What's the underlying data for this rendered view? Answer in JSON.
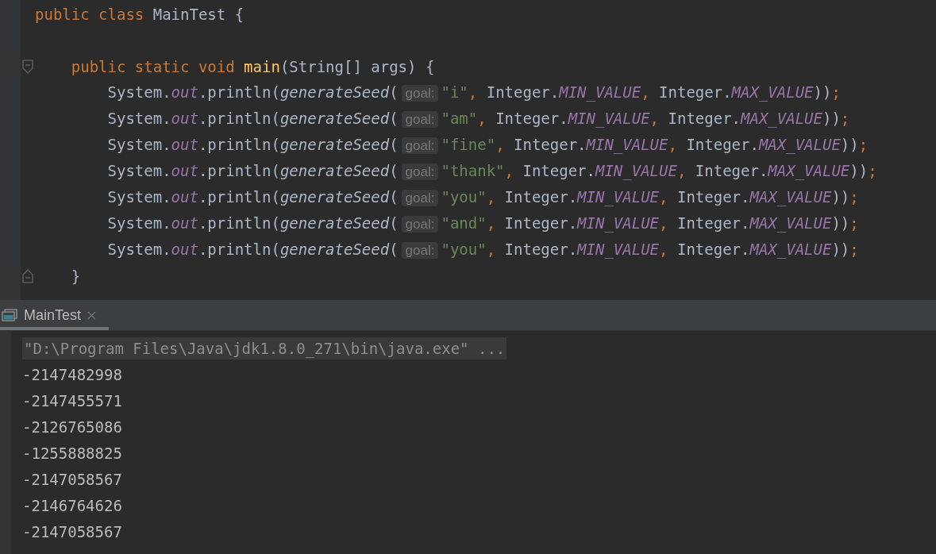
{
  "editor": {
    "lines": [
      {
        "kind": "code",
        "tokens": [
          {
            "kind": "keyword",
            "text": "public class "
          },
          {
            "kind": "plain",
            "text": "MainTest {"
          }
        ]
      },
      {
        "kind": "blank"
      },
      {
        "kind": "fold-start",
        "tokens": [
          {
            "kind": "keyword",
            "text": "    public static void "
          },
          {
            "kind": "decl",
            "text": "main"
          },
          {
            "kind": "plain",
            "text": "(String[] args) {"
          }
        ]
      },
      {
        "kind": "code",
        "tokens": [
          {
            "kind": "plain",
            "text": "        System."
          },
          {
            "kind": "field",
            "text": "out"
          },
          {
            "kind": "plain",
            "text": ".println("
          },
          {
            "kind": "static-call",
            "text": "generateSeed"
          },
          {
            "kind": "plain",
            "text": "("
          },
          {
            "kind": "hint",
            "text": "goal:"
          },
          {
            "kind": "string",
            "text": "\"i\""
          },
          {
            "kind": "punct",
            "text": ", "
          },
          {
            "kind": "plain",
            "text": "Integer."
          },
          {
            "kind": "field",
            "text": "MIN_VALUE"
          },
          {
            "kind": "punct",
            "text": ", "
          },
          {
            "kind": "plain",
            "text": "Integer."
          },
          {
            "kind": "field",
            "text": "MAX_VALUE"
          },
          {
            "kind": "plain",
            "text": "))"
          },
          {
            "kind": "punct",
            "text": ";"
          }
        ]
      },
      {
        "kind": "code",
        "tokens": [
          {
            "kind": "plain",
            "text": "        System."
          },
          {
            "kind": "field",
            "text": "out"
          },
          {
            "kind": "plain",
            "text": ".println("
          },
          {
            "kind": "static-call",
            "text": "generateSeed"
          },
          {
            "kind": "plain",
            "text": "("
          },
          {
            "kind": "hint",
            "text": "goal:"
          },
          {
            "kind": "string",
            "text": "\"am\""
          },
          {
            "kind": "punct",
            "text": ", "
          },
          {
            "kind": "plain",
            "text": "Integer."
          },
          {
            "kind": "field",
            "text": "MIN_VALUE"
          },
          {
            "kind": "punct",
            "text": ", "
          },
          {
            "kind": "plain",
            "text": "Integer."
          },
          {
            "kind": "field",
            "text": "MAX_VALUE"
          },
          {
            "kind": "plain",
            "text": "))"
          },
          {
            "kind": "punct",
            "text": ";"
          }
        ]
      },
      {
        "kind": "code",
        "tokens": [
          {
            "kind": "plain",
            "text": "        System."
          },
          {
            "kind": "field",
            "text": "out"
          },
          {
            "kind": "plain",
            "text": ".println("
          },
          {
            "kind": "static-call",
            "text": "generateSeed"
          },
          {
            "kind": "plain",
            "text": "("
          },
          {
            "kind": "hint",
            "text": "goal:"
          },
          {
            "kind": "string",
            "text": "\"fine\""
          },
          {
            "kind": "punct",
            "text": ", "
          },
          {
            "kind": "plain",
            "text": "Integer."
          },
          {
            "kind": "field",
            "text": "MIN_VALUE"
          },
          {
            "kind": "punct",
            "text": ", "
          },
          {
            "kind": "plain",
            "text": "Integer."
          },
          {
            "kind": "field",
            "text": "MAX_VALUE"
          },
          {
            "kind": "plain",
            "text": "))"
          },
          {
            "kind": "punct",
            "text": ";"
          }
        ]
      },
      {
        "kind": "code",
        "tokens": [
          {
            "kind": "plain",
            "text": "        System."
          },
          {
            "kind": "field",
            "text": "out"
          },
          {
            "kind": "plain",
            "text": ".println("
          },
          {
            "kind": "static-call",
            "text": "generateSeed"
          },
          {
            "kind": "plain",
            "text": "("
          },
          {
            "kind": "hint",
            "text": "goal:"
          },
          {
            "kind": "string",
            "text": "\"thank\""
          },
          {
            "kind": "punct",
            "text": ", "
          },
          {
            "kind": "plain",
            "text": "Integer."
          },
          {
            "kind": "field",
            "text": "MIN_VALUE"
          },
          {
            "kind": "punct",
            "text": ", "
          },
          {
            "kind": "plain",
            "text": "Integer."
          },
          {
            "kind": "field",
            "text": "MAX_VALUE"
          },
          {
            "kind": "plain",
            "text": "))"
          },
          {
            "kind": "punct",
            "text": ";"
          }
        ]
      },
      {
        "kind": "code",
        "tokens": [
          {
            "kind": "plain",
            "text": "        System."
          },
          {
            "kind": "field",
            "text": "out"
          },
          {
            "kind": "plain",
            "text": ".println("
          },
          {
            "kind": "static-call",
            "text": "generateSeed"
          },
          {
            "kind": "plain",
            "text": "("
          },
          {
            "kind": "hint",
            "text": "goal:"
          },
          {
            "kind": "string",
            "text": "\"you\""
          },
          {
            "kind": "punct",
            "text": ", "
          },
          {
            "kind": "plain",
            "text": "Integer."
          },
          {
            "kind": "field",
            "text": "MIN_VALUE"
          },
          {
            "kind": "punct",
            "text": ", "
          },
          {
            "kind": "plain",
            "text": "Integer."
          },
          {
            "kind": "field",
            "text": "MAX_VALUE"
          },
          {
            "kind": "plain",
            "text": "))"
          },
          {
            "kind": "punct",
            "text": ";"
          }
        ]
      },
      {
        "kind": "code",
        "tokens": [
          {
            "kind": "plain",
            "text": "        System."
          },
          {
            "kind": "field",
            "text": "out"
          },
          {
            "kind": "plain",
            "text": ".println("
          },
          {
            "kind": "static-call",
            "text": "generateSeed"
          },
          {
            "kind": "plain",
            "text": "("
          },
          {
            "kind": "hint",
            "text": "goal:"
          },
          {
            "kind": "string",
            "text": "\"and\""
          },
          {
            "kind": "punct",
            "text": ", "
          },
          {
            "kind": "plain",
            "text": "Integer."
          },
          {
            "kind": "field",
            "text": "MIN_VALUE"
          },
          {
            "kind": "punct",
            "text": ", "
          },
          {
            "kind": "plain",
            "text": "Integer."
          },
          {
            "kind": "field",
            "text": "MAX_VALUE"
          },
          {
            "kind": "plain",
            "text": "))"
          },
          {
            "kind": "punct",
            "text": ";"
          }
        ]
      },
      {
        "kind": "code",
        "tokens": [
          {
            "kind": "plain",
            "text": "        System."
          },
          {
            "kind": "field",
            "text": "out"
          },
          {
            "kind": "plain",
            "text": ".println("
          },
          {
            "kind": "static-call",
            "text": "generateSeed"
          },
          {
            "kind": "plain",
            "text": "("
          },
          {
            "kind": "hint",
            "text": "goal:"
          },
          {
            "kind": "string",
            "text": "\"you\""
          },
          {
            "kind": "punct",
            "text": ", "
          },
          {
            "kind": "plain",
            "text": "Integer."
          },
          {
            "kind": "field",
            "text": "MIN_VALUE"
          },
          {
            "kind": "punct",
            "text": ", "
          },
          {
            "kind": "plain",
            "text": "Integer."
          },
          {
            "kind": "field",
            "text": "MAX_VALUE"
          },
          {
            "kind": "plain",
            "text": "))"
          },
          {
            "kind": "punct",
            "text": ";"
          }
        ]
      },
      {
        "kind": "fold-end",
        "tokens": [
          {
            "kind": "plain",
            "text": "    }"
          }
        ]
      }
    ]
  },
  "run_panel": {
    "tabs": [
      {
        "label": "MainTest",
        "selected": true
      }
    ],
    "output": [
      {
        "kind": "command",
        "text": "\"D:\\Program Files\\Java\\jdk1.8.0_271\\bin\\java.exe\" ..."
      },
      {
        "kind": "stdout",
        "text": "-2147482998"
      },
      {
        "kind": "stdout",
        "text": "-2147455571"
      },
      {
        "kind": "stdout",
        "text": "-2126765086"
      },
      {
        "kind": "stdout",
        "text": "-1255888825"
      },
      {
        "kind": "stdout",
        "text": "-2147058567"
      },
      {
        "kind": "stdout",
        "text": "-2146764626"
      },
      {
        "kind": "stdout",
        "text": "-2147058567"
      }
    ]
  }
}
